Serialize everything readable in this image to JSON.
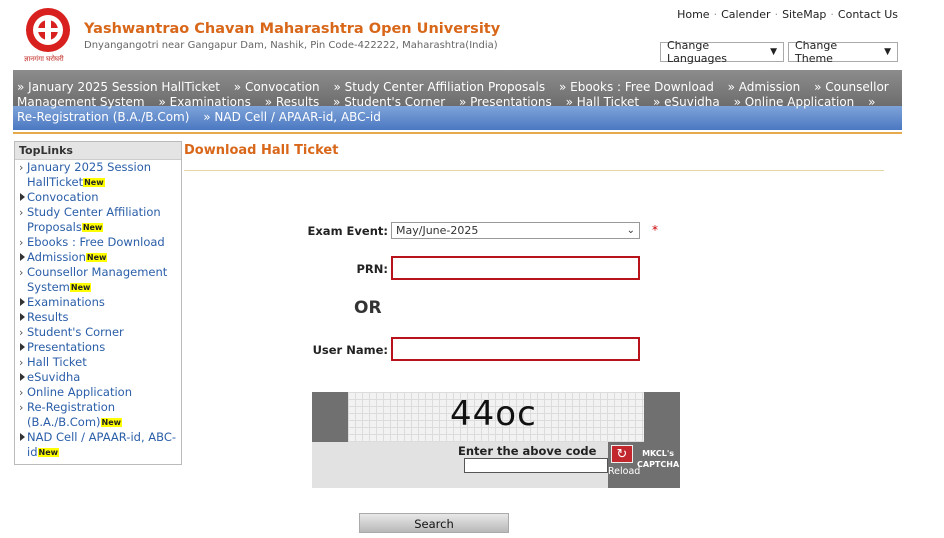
{
  "header": {
    "title": "Yashwantrao Chavan Maharashtra Open University",
    "address": "Dnyangangotri near Gangapur Dam, Nashik, Pin Code-422222, Maharashtra(India)",
    "logo_caption": "ज्ञानगंगा घरोघरी",
    "top_links": [
      "Home",
      "Calender",
      "SiteMap",
      "Contact Us"
    ],
    "change_languages": "Change Languages",
    "change_theme": "Change Theme"
  },
  "nav": {
    "items": [
      "» January 2025 Session HallTicket",
      "» Convocation",
      "» Study Center Affiliation Proposals",
      "» Ebooks : Free Download",
      "» Admission",
      "» Counsellor Management System",
      "» Examinations",
      "» Results",
      "» Student's Corner",
      "» Presentations",
      "» Hall Ticket",
      "» eSuvidha",
      "» Online Application",
      "» Re-Registration (B.A./B.Com)",
      "» NAD Cell / APAAR-id, ABC-id"
    ]
  },
  "sidebar": {
    "heading": "TopLinks",
    "new_badge": "New",
    "items": [
      {
        "label": "January 2025 Session HallTicket",
        "new": true,
        "marker": "chev"
      },
      {
        "label": "Convocation",
        "new": false,
        "marker": "tri"
      },
      {
        "label": "Study Center Affiliation Proposals",
        "new": true,
        "marker": "chev"
      },
      {
        "label": "Ebooks : Free Download",
        "new": false,
        "marker": "chev"
      },
      {
        "label": "Admission",
        "new": true,
        "marker": "tri"
      },
      {
        "label": "Counsellor Management System",
        "new": true,
        "marker": "chev"
      },
      {
        "label": "Examinations",
        "new": false,
        "marker": "tri"
      },
      {
        "label": "Results",
        "new": false,
        "marker": "tri"
      },
      {
        "label": "Student's Corner",
        "new": false,
        "marker": "chev"
      },
      {
        "label": "Presentations",
        "new": false,
        "marker": "tri"
      },
      {
        "label": "Hall Ticket",
        "new": false,
        "marker": "chev"
      },
      {
        "label": "eSuvidha",
        "new": false,
        "marker": "tri"
      },
      {
        "label": "Online Application",
        "new": false,
        "marker": "chev"
      },
      {
        "label": "Re-Registration (B.A./B.Com)",
        "new": true,
        "marker": "chev"
      },
      {
        "label": "NAD Cell / APAAR-id, ABC-id",
        "new": true,
        "marker": "tri"
      }
    ]
  },
  "main": {
    "title": "Download Hall Ticket",
    "exam_event_label": "Exam Event:",
    "exam_event_value": "May/June-2025",
    "required_mark": "*",
    "prn_label": "PRN:",
    "prn_value": "",
    "or_text": "OR",
    "username_label": "User Name:",
    "username_value": ""
  },
  "captcha": {
    "code": "44oc",
    "prompt": "Enter the above code",
    "reload_label": "Reload",
    "brand_line1": "MKCL's",
    "brand_line2": "CAPTCHA",
    "value": ""
  },
  "actions": {
    "search_label": "Search"
  },
  "colors": {
    "brand_orange": "#d8671a",
    "nav_gray": "#7a7a7a",
    "nav_blue": "#5a85c8",
    "link_blue": "#2a5ea8",
    "input_border_red": "#b8121a"
  }
}
